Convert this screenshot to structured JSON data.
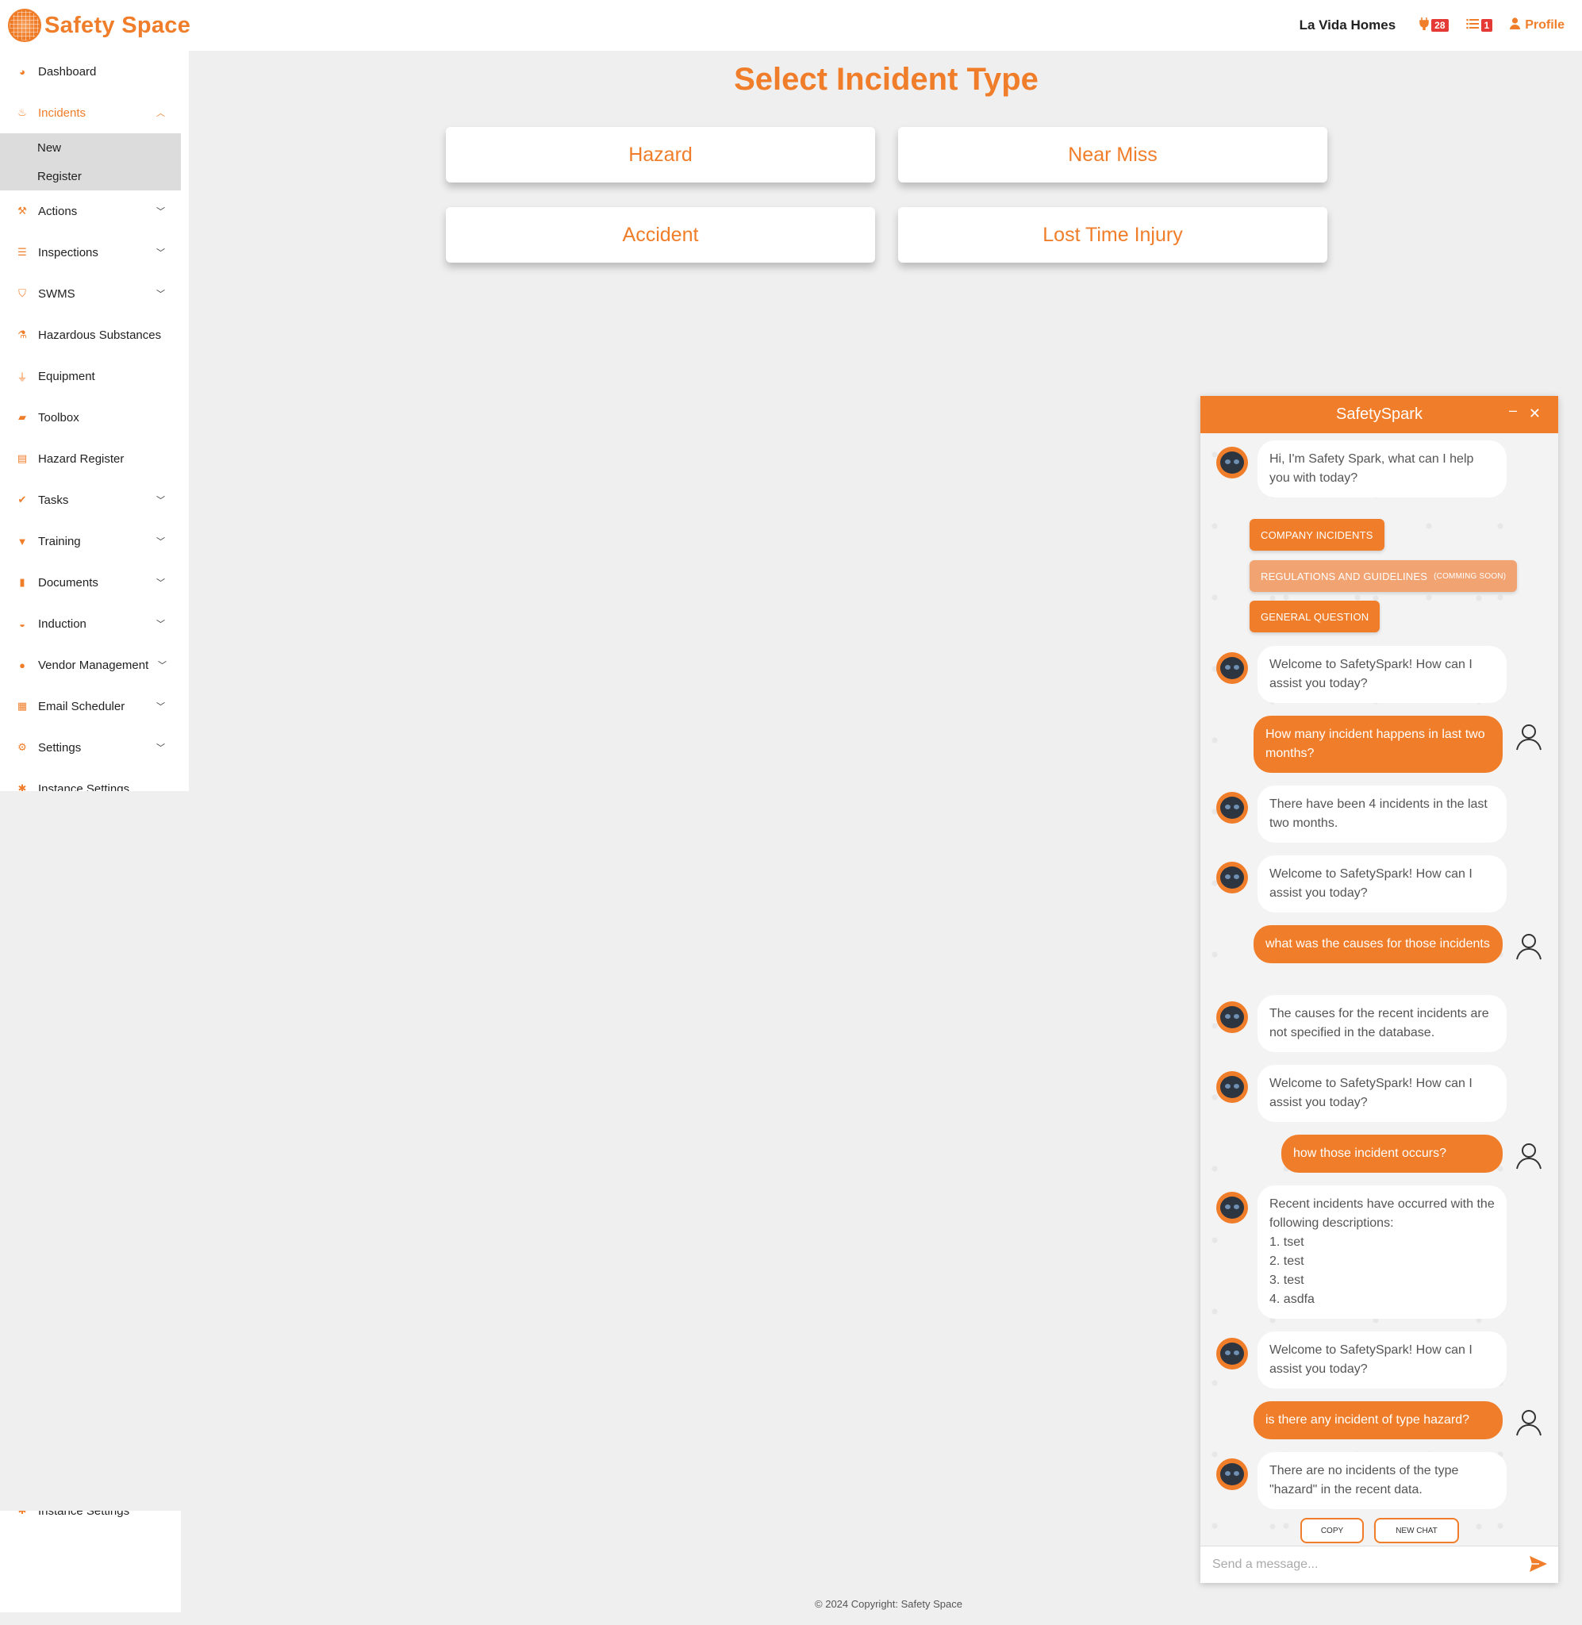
{
  "brand": {
    "name": "Safety Space"
  },
  "header": {
    "company": "La Vida Homes",
    "notif_count": "28",
    "task_count": "1",
    "profile_label": "Profile"
  },
  "sidebar": {
    "items": [
      {
        "label": "Dashboard",
        "icon": "gauge-icon"
      },
      {
        "label": "Incidents",
        "icon": "flame-icon"
      },
      {
        "label": "Actions",
        "icon": "hammer-icon"
      },
      {
        "label": "Inspections",
        "icon": "list-icon"
      },
      {
        "label": "SWMS",
        "icon": "shield-icon"
      },
      {
        "label": "Hazardous Substances",
        "icon": "flask-icon"
      },
      {
        "label": "Equipment",
        "icon": "plug-icon"
      },
      {
        "label": "Toolbox",
        "icon": "toolbox-icon"
      },
      {
        "label": "Hazard Register",
        "icon": "table-icon"
      },
      {
        "label": "Tasks",
        "icon": "check-icon"
      },
      {
        "label": "Training",
        "icon": "graduation-icon"
      },
      {
        "label": "Documents",
        "icon": "file-icon"
      },
      {
        "label": "Induction",
        "icon": "hardhat-icon"
      },
      {
        "label": "Vendor Management",
        "icon": "users-icon"
      },
      {
        "label": "Email Scheduler",
        "icon": "calendar-icon"
      },
      {
        "label": "Settings",
        "icon": "gears-icon"
      },
      {
        "label": "Instance Settings",
        "icon": "cog-icon"
      }
    ],
    "incidents_sub": [
      "New",
      "Register"
    ]
  },
  "main": {
    "title": "Select Incident Type",
    "types": [
      "Hazard",
      "Near Miss",
      "Accident",
      "Lost Time Injury"
    ]
  },
  "footer": "© 2024 Copyright: Safety Space",
  "chat": {
    "title": "SafetySpark",
    "greeting": "Hi, I'm Safety Spark, what can I help you with today?",
    "quick_company": "COMPANY INCIDENTS",
    "quick_regulations": "REGULATIONS AND GUIDELINES",
    "quick_regulations_note": "(COMMING SOON)",
    "quick_general": "GENERAL QUESTION",
    "welcome": "Welcome to SafetySpark! How can I assist you today?",
    "messages": [
      "How many incident happens in last two months?",
      "There have been 4 incidents in the last two months.",
      "what was the causes for those incidents",
      "The causes for the recent incidents are not specified in the database.",
      "how those incident occurs?",
      "Recent incidents have occurred with the following descriptions:",
      "1. tset",
      "2. test",
      "3. test",
      "4. asdfa",
      "is there any incident of type hazard?",
      "There are no incidents of the type \"hazard\" in the recent data."
    ],
    "copy_label": "COPY",
    "new_chat_label": "NEW CHAT",
    "input_placeholder": "Send a message..."
  },
  "colors": {
    "accent": "#f07d29",
    "badge": "#e53935"
  }
}
